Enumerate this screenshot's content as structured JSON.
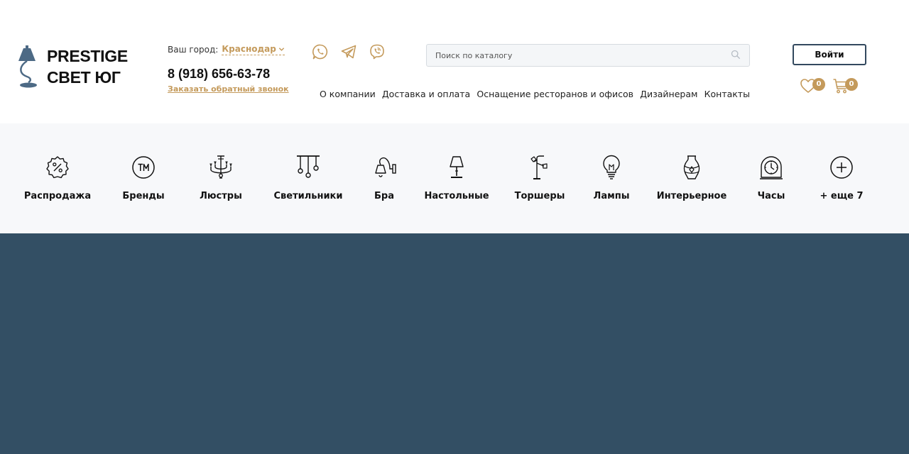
{
  "logo": {
    "line1": "PRESTIGE",
    "line2": "СВЕТ ЮГ"
  },
  "city": {
    "label": "Ваш город:",
    "value": "Краснодар"
  },
  "phone": "8 (918) 656-63-78",
  "callback": "Заказать обратный звонок",
  "messengers": [
    {
      "name": "whatsapp-icon"
    },
    {
      "name": "telegram-icon"
    },
    {
      "name": "viber-icon"
    }
  ],
  "search": {
    "placeholder": "Поиск по каталогу",
    "value": ""
  },
  "nav": [
    {
      "label": "О компании"
    },
    {
      "label": "Доставка и оплата"
    },
    {
      "label": "Оснащение ресторанов и офисов"
    },
    {
      "label": "Дизайнерам"
    },
    {
      "label": "Контакты"
    }
  ],
  "login_label": "Войти",
  "favorites": {
    "count": "0",
    "icon": "heart-icon"
  },
  "cart": {
    "count": "0",
    "icon": "cart-icon"
  },
  "categories": [
    {
      "label": "Распродажа",
      "icon": "sale-badge-icon"
    },
    {
      "label": "Бренды",
      "icon": "trademark-icon"
    },
    {
      "label": "Люстры",
      "icon": "chandelier-icon"
    },
    {
      "label": "Светильники",
      "icon": "pendant-lamps-icon"
    },
    {
      "label": "Бра",
      "icon": "wall-lamp-icon"
    },
    {
      "label": "Настольные",
      "icon": "table-lamp-icon"
    },
    {
      "label": "Торшеры",
      "icon": "floor-lamp-icon"
    },
    {
      "label": "Лампы",
      "icon": "light-bulb-icon"
    },
    {
      "label": "Интерьерное",
      "icon": "vase-icon"
    },
    {
      "label": "Часы",
      "icon": "clock-icon"
    },
    {
      "label": "+ еще 7",
      "icon": "plus-circle-icon"
    }
  ],
  "colors": {
    "accent": "#c49a5b",
    "logo_blue": "#4d6a85",
    "hero": "#334f64",
    "category_bg": "#f7f8fa"
  }
}
